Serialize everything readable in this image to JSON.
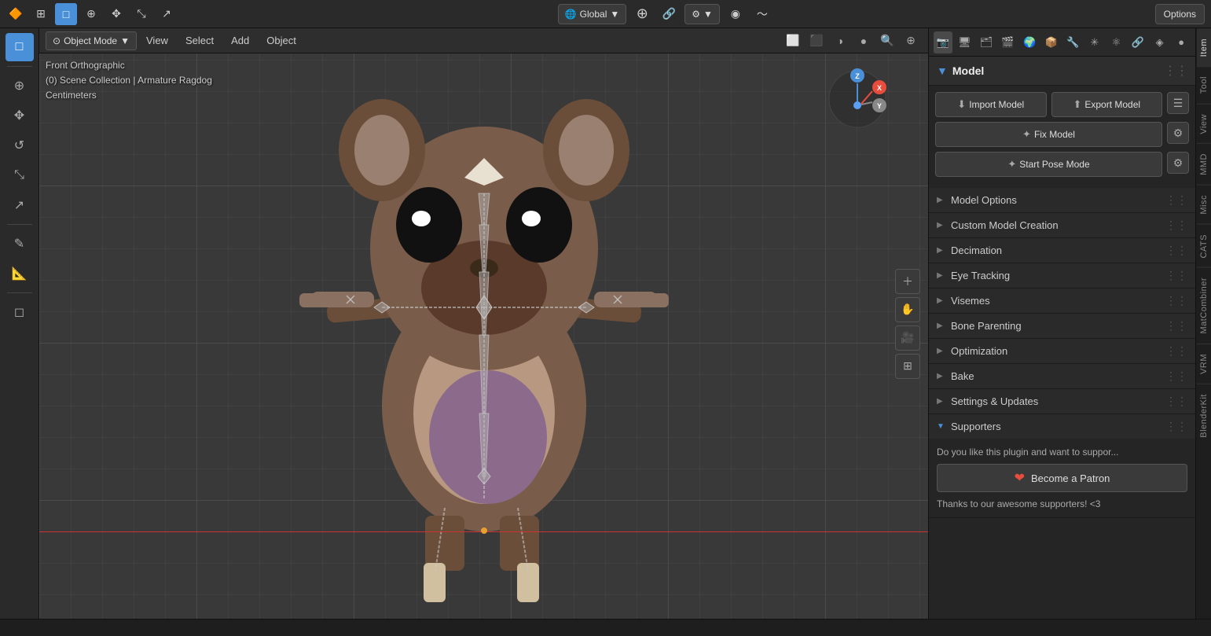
{
  "app": {
    "title": "Blender",
    "options_label": "Options"
  },
  "top_bar": {
    "transform_orientation": "Global",
    "pivot_icon": "⊕",
    "snap_icon": "🔧",
    "proportional_icon": "○",
    "overlay_icon": "⊙",
    "shading_icon": "◑"
  },
  "viewport_menu": {
    "mode_label": "Object Mode",
    "items": [
      "View",
      "Select",
      "Add",
      "Object"
    ]
  },
  "viewport_info": {
    "line1": "Front Orthographic",
    "line2": "(0) Scene Collection | Armature Ragdog",
    "line3": "Centimeters"
  },
  "right_panel": {
    "title": "Model",
    "import_button": "Import Model",
    "export_button": "Export Model",
    "fix_model_button": "Fix Model",
    "start_pose_button": "Start Pose Mode",
    "sections": [
      {
        "id": "model-options",
        "label": "Model Options",
        "expanded": false
      },
      {
        "id": "custom-model-creation",
        "label": "Custom Model Creation",
        "expanded": false
      },
      {
        "id": "decimation",
        "label": "Decimation",
        "expanded": false
      },
      {
        "id": "eye-tracking",
        "label": "Eye Tracking",
        "expanded": false
      },
      {
        "id": "visemes",
        "label": "Visemes",
        "expanded": false
      },
      {
        "id": "bone-parenting",
        "label": "Bone Parenting",
        "expanded": false
      },
      {
        "id": "optimization",
        "label": "Optimization",
        "expanded": false
      },
      {
        "id": "bake",
        "label": "Bake",
        "expanded": false
      },
      {
        "id": "settings-updates",
        "label": "Settings & Updates",
        "expanded": false
      }
    ],
    "supporters": {
      "label": "Supporters",
      "support_text": "Do you like this plugin and want to suppor...",
      "patron_button": "Become a Patron",
      "thanks_text": "Thanks to our awesome supporters! <3"
    }
  },
  "side_tabs": [
    "Item",
    "Tool",
    "View",
    "MMD",
    "Misc",
    "CATS",
    "MatCombiner",
    "VRM",
    "BlenderKit"
  ],
  "tools": {
    "left": [
      {
        "id": "cursor",
        "icon": "⊕",
        "active": false
      },
      {
        "id": "select-box",
        "icon": "□",
        "active": true
      },
      {
        "id": "move",
        "icon": "✥",
        "active": false
      },
      {
        "id": "rotate",
        "icon": "↺",
        "active": false
      },
      {
        "id": "scale",
        "icon": "⤡",
        "active": false
      },
      {
        "id": "transform",
        "icon": "↗",
        "active": false
      },
      {
        "id": "annotate",
        "icon": "✎",
        "active": false
      },
      {
        "id": "measure",
        "icon": "📏",
        "active": false
      },
      {
        "id": "add-cube",
        "icon": "◻",
        "active": false
      }
    ]
  }
}
